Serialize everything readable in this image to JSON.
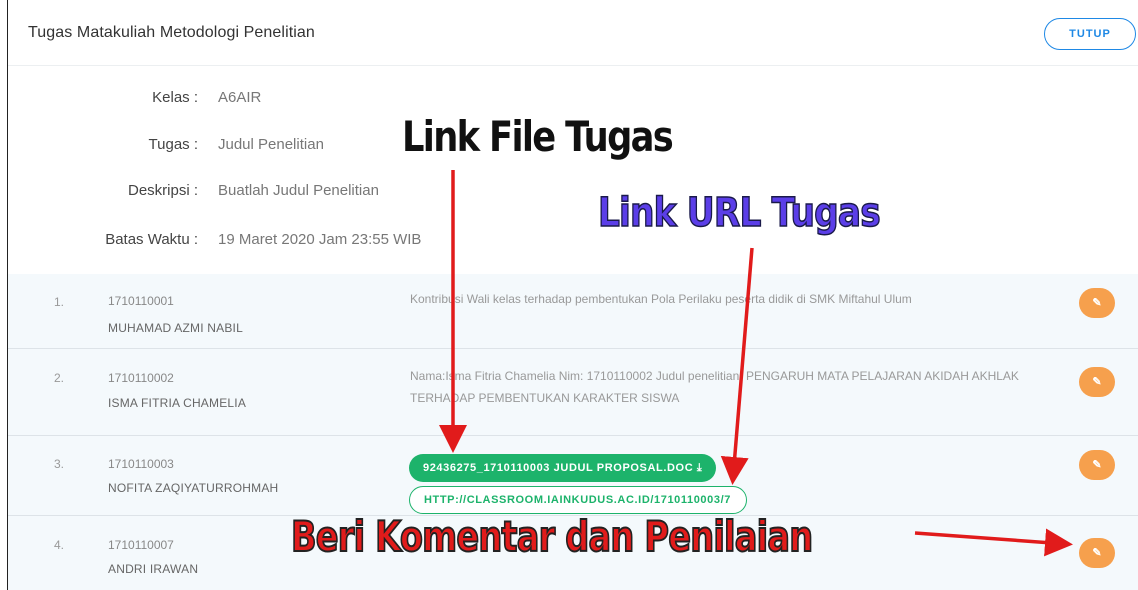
{
  "header": {
    "title": "Tugas Matakuliah Metodologi Penelitian",
    "close_label": "TUTUP"
  },
  "info": {
    "kelas_label": "Kelas :",
    "kelas_value": "A6AIR",
    "tugas_label": "Tugas :",
    "tugas_value": "Judul Penelitian",
    "deskripsi_label": "Deskripsi :",
    "deskripsi_value": "Buatlah Judul Penelitian",
    "batas_label": "Batas Waktu :",
    "batas_value": "19 Maret 2020 Jam 23:55 WIB"
  },
  "rows": [
    {
      "no": "1.",
      "nim": "1710110001",
      "name": "MUHAMAD AZMI NABIL",
      "text": "Kontribusi Wali kelas terhadap pembentukan Pola Perilaku peserta didik di SMK Miftahul Ulum"
    },
    {
      "no": "2.",
      "nim": "1710110002",
      "name": "ISMA FITRIA CHAMELIA",
      "text": "Nama:Isma Fitria Chamelia Nim: 1710110002 Judul penelitian: PENGARUH MATA PELAJARAN AKIDAH AKHLAK TERHADAP PEMBENTUKAN KARAKTER SISWA"
    },
    {
      "no": "3.",
      "nim": "1710110003",
      "name": "NOFITA ZAQIYATURROHMAH",
      "file_label": "92436275_1710110003 JUDUL PROPOSAL.DOC",
      "download_icon": "⤓",
      "url_label": "HTTP://CLASSROOM.IAINKUDUS.AC.ID/1710110003/7"
    },
    {
      "no": "4.",
      "nim": "1710110007",
      "name": "ANDRI IRAWAN"
    }
  ],
  "action_button_label": "✎",
  "annotations": {
    "file": "Link File Tugas",
    "url": "Link URL Tugas",
    "komentar": "Beri Komentar dan Penilaian"
  },
  "colors": {
    "accent_blue": "#1e88e5",
    "green": "#1db36b",
    "orange": "#f6a04d",
    "arrow_red": "#e11b1b",
    "annot_purple": "#5b3ee8"
  }
}
